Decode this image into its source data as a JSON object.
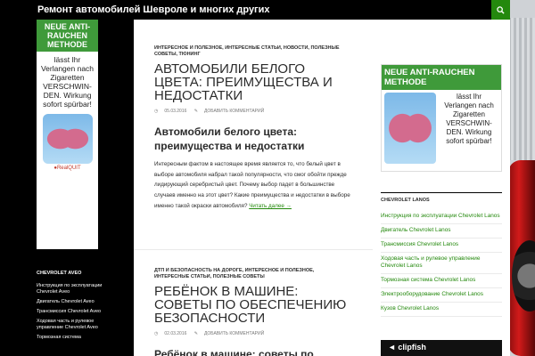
{
  "header": {
    "site_title": "Ремонт автомобилей Шевроле и многих других"
  },
  "colors": {
    "accent": "#24890d",
    "header_bg": "#000000",
    "ad_green": "#3f9a3a"
  },
  "left_ad": {
    "title": "NEUE ANTI-RAUCHEN METHODE",
    "text": "lässt Ihr Verlangen nach Zigaretten VERSCHWIN-DEN. Wirkung sofort spürbar!",
    "brand": "●RealQUIT"
  },
  "sidebar": {
    "title": "Chevrolet Aveo",
    "items": [
      "Инструкция по эксплуатации Chevrolet Aveo",
      "Двигатель Chevrolet Aveo",
      "Трансмиссия Chevrolet Aveo",
      "Ходовая часть и рулевое управление Chevrolet Aveo",
      "Тормозная система"
    ]
  },
  "articles": [
    {
      "categories": "Интересное и полезное, Интересные статьи, Новости, Полезные советы, Тюнинг",
      "title": "Автомобили белого цвета: преимущества и недостатки",
      "date": "05.03.2016",
      "comment_link": "Добавить комментарий",
      "subtitle": "Автомобили белого цвета: преимущества и недостатки",
      "body": "Интересным фактом в настоящее время является то, что белый цвет в выборе автомобиля набрал такой популярности, что смог обойти прежде лидирующий серебристый цвет. Почему выбор падет в большинстве случаев именно на этот цвет? Какие преимущества и недостатки в выборе именно такой окраски автомобиля?",
      "read_more": "Читать далее →"
    },
    {
      "categories": "ДТП и безопасность на дороге, Интересное и полезное, Интересные статьи, Полезные советы",
      "title": "Ребёнок в машине: советы по обеспечению безопасности",
      "date": "02.03.2016",
      "comment_link": "Добавить комментарий",
      "subtitle": "Ребёнок в машине: советы по"
    }
  ],
  "right_ad": {
    "title": "NEUE ANTI-RAUCHEN METHODE",
    "text": "lässt Ihr Verlangen nach Zigaretten VERSCHWIN-DEN. Wirkung sofort spürbar!"
  },
  "right_widget": {
    "title": "Chevrolet Lanos",
    "items": [
      "Инструкция по эксплуатации Chevrolet Lanos",
      "Двигатель Chevrolet Lanos",
      "Трансмиссия Chevrolet Lanos",
      "Ходовая часть и рулевое управление Chevrolet Lanos",
      "Тормозная система Chevrolet Lanos",
      "Электрооборудование Chevrolet Lanos",
      "Кузов Chevrolet Lanos"
    ]
  },
  "bottom_ad": {
    "brand": "◄ clipfish"
  }
}
